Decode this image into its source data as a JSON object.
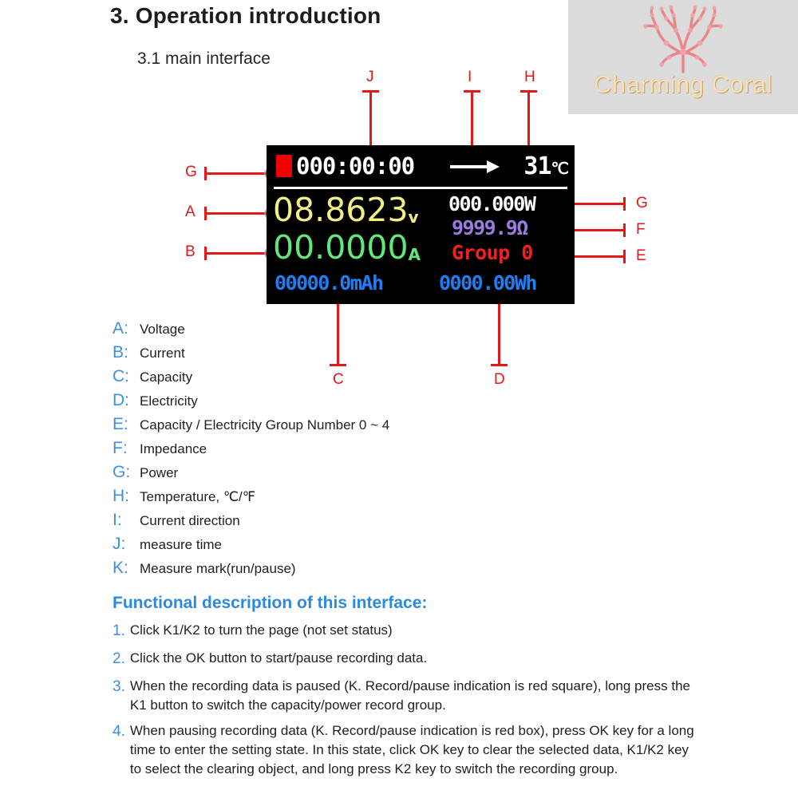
{
  "brand": {
    "name": "Charming Coral",
    "icon": "coral-icon",
    "bg_color": "#dcdcdc",
    "text_color": "#f2e3c4"
  },
  "headings": {
    "main": "3. Operation introduction",
    "sub": "3.1 main interface"
  },
  "display": {
    "background": "#000000",
    "record_indicator": {
      "name": "record-pause-indicator",
      "color": "#ef0000",
      "state": "paused"
    },
    "time": "000:00:00",
    "direction_icon": "arrow-right-icon",
    "temperature": "31",
    "temperature_unit": "℃",
    "voltage": "08.8623",
    "voltage_unit": "v",
    "voltage_color": "#f4ef82",
    "current": "00.0000",
    "current_unit": "A",
    "current_color": "#62e87a",
    "power": "000.000W",
    "power_color": "#ffffff",
    "impedance": "9999.9Ω",
    "impedance_color": "#9a7ce0",
    "group": "Group  0",
    "group_color": "#f42020",
    "capacity": "00000.0mAh",
    "energy": "0000.00Wh",
    "bottom_color": "#1f7ff0"
  },
  "callouts": [
    {
      "id": "J",
      "label": "J"
    },
    {
      "id": "I",
      "label": "I"
    },
    {
      "id": "H",
      "label": "H"
    },
    {
      "id": "G-left",
      "label": "G"
    },
    {
      "id": "A",
      "label": "A"
    },
    {
      "id": "B",
      "label": "B"
    },
    {
      "id": "G-right",
      "label": "G"
    },
    {
      "id": "F",
      "label": "F"
    },
    {
      "id": "E",
      "label": "E"
    },
    {
      "id": "C",
      "label": "C"
    },
    {
      "id": "D",
      "label": "D"
    }
  ],
  "legend": [
    {
      "key": "A:",
      "text": "Voltage"
    },
    {
      "key": "B:",
      "text": "Current"
    },
    {
      "key": "C:",
      "text": "Capacity"
    },
    {
      "key": "D:",
      "text": "Electricity"
    },
    {
      "key": "E:",
      "text": "Capacity / Electricity Group Number 0 ~ 4"
    },
    {
      "key": "F:",
      "text": "Impedance"
    },
    {
      "key": "G:",
      "text": "Power"
    },
    {
      "key": "H:",
      "text": "Temperature, ℃/℉"
    },
    {
      "key": "I:",
      "text": "Current direction"
    },
    {
      "key": "J:",
      "text": "measure time"
    },
    {
      "key": "K:",
      "text": "Measure mark(run/pause)"
    }
  ],
  "functional": {
    "heading": "Functional description of this interface:",
    "items": [
      {
        "num": "1.",
        "text": "Click K1/K2 to turn the page (not set status)"
      },
      {
        "num": "2.",
        "text": "Click the OK button to start/pause recording data."
      },
      {
        "num": "3.",
        "text": "When the recording data is paused (K. Record/pause indication is red square), long press the K1 button to switch the capacity/power record group."
      },
      {
        "num": "4.",
        "text": "When pausing recording data (K. Record/pause indication is red box), press OK key for a long time to enter the setting state. In this state, click OK key to clear the selected data, K1/K2 key to select the clearing object, and long press K2 key to switch the recording group."
      }
    ]
  }
}
